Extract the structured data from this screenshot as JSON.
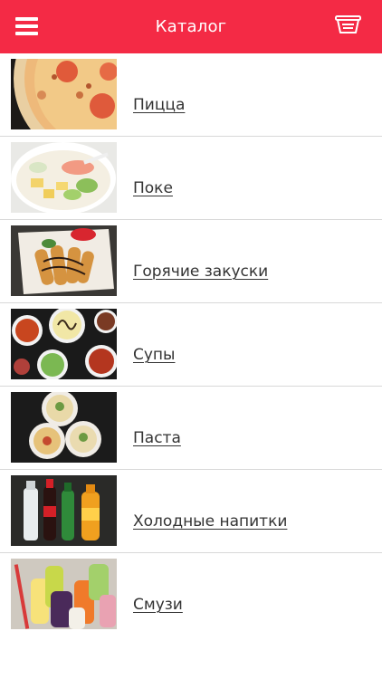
{
  "header": {
    "title": "Каталог",
    "menu_icon": "hamburger-menu-icon",
    "cart_icon": "basket-icon",
    "color": "#f42a45"
  },
  "catalog": {
    "items": [
      {
        "label": "Пицца",
        "image": "pizza-image"
      },
      {
        "label": "Поке",
        "image": "poke-bowl-image"
      },
      {
        "label": "Горячие закуски",
        "image": "hot-snacks-image"
      },
      {
        "label": "Супы",
        "image": "soups-image"
      },
      {
        "label": "Паста",
        "image": "pasta-image"
      },
      {
        "label": "Холодные напитки",
        "image": "cold-drinks-image"
      },
      {
        "label": "Смузи",
        "image": "smoothies-image"
      }
    ]
  }
}
